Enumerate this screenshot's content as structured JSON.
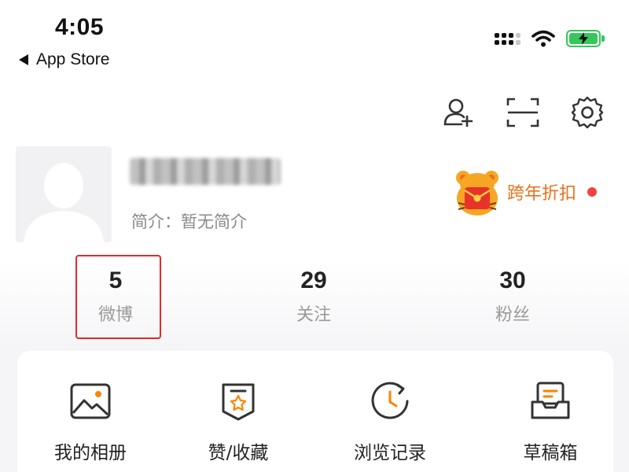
{
  "status_bar": {
    "time": "4:05",
    "back_app": "App Store",
    "battery_color": "#34c759"
  },
  "top_icons": [
    "add-friend-icon",
    "scan-icon",
    "settings-icon"
  ],
  "profile": {
    "username": "",
    "bio": "简介：暂无简介",
    "promo_label": "跨年折扣",
    "promo_color": "#e8721c",
    "notification_dot_color": "#f4433a"
  },
  "stats": [
    {
      "value": "5",
      "label": "微博"
    },
    {
      "value": "29",
      "label": "关注"
    },
    {
      "value": "30",
      "label": "粉丝"
    }
  ],
  "highlight_color": "#e02a2a",
  "shortcuts": [
    {
      "label": "我的相册",
      "icon": "photo-album-icon"
    },
    {
      "label": "赞/收藏",
      "icon": "likes-favorites-icon"
    },
    {
      "label": "浏览记录",
      "icon": "browsing-history-icon"
    },
    {
      "label": "草稿箱",
      "icon": "drafts-icon"
    }
  ],
  "accent_color": "#ff8200"
}
